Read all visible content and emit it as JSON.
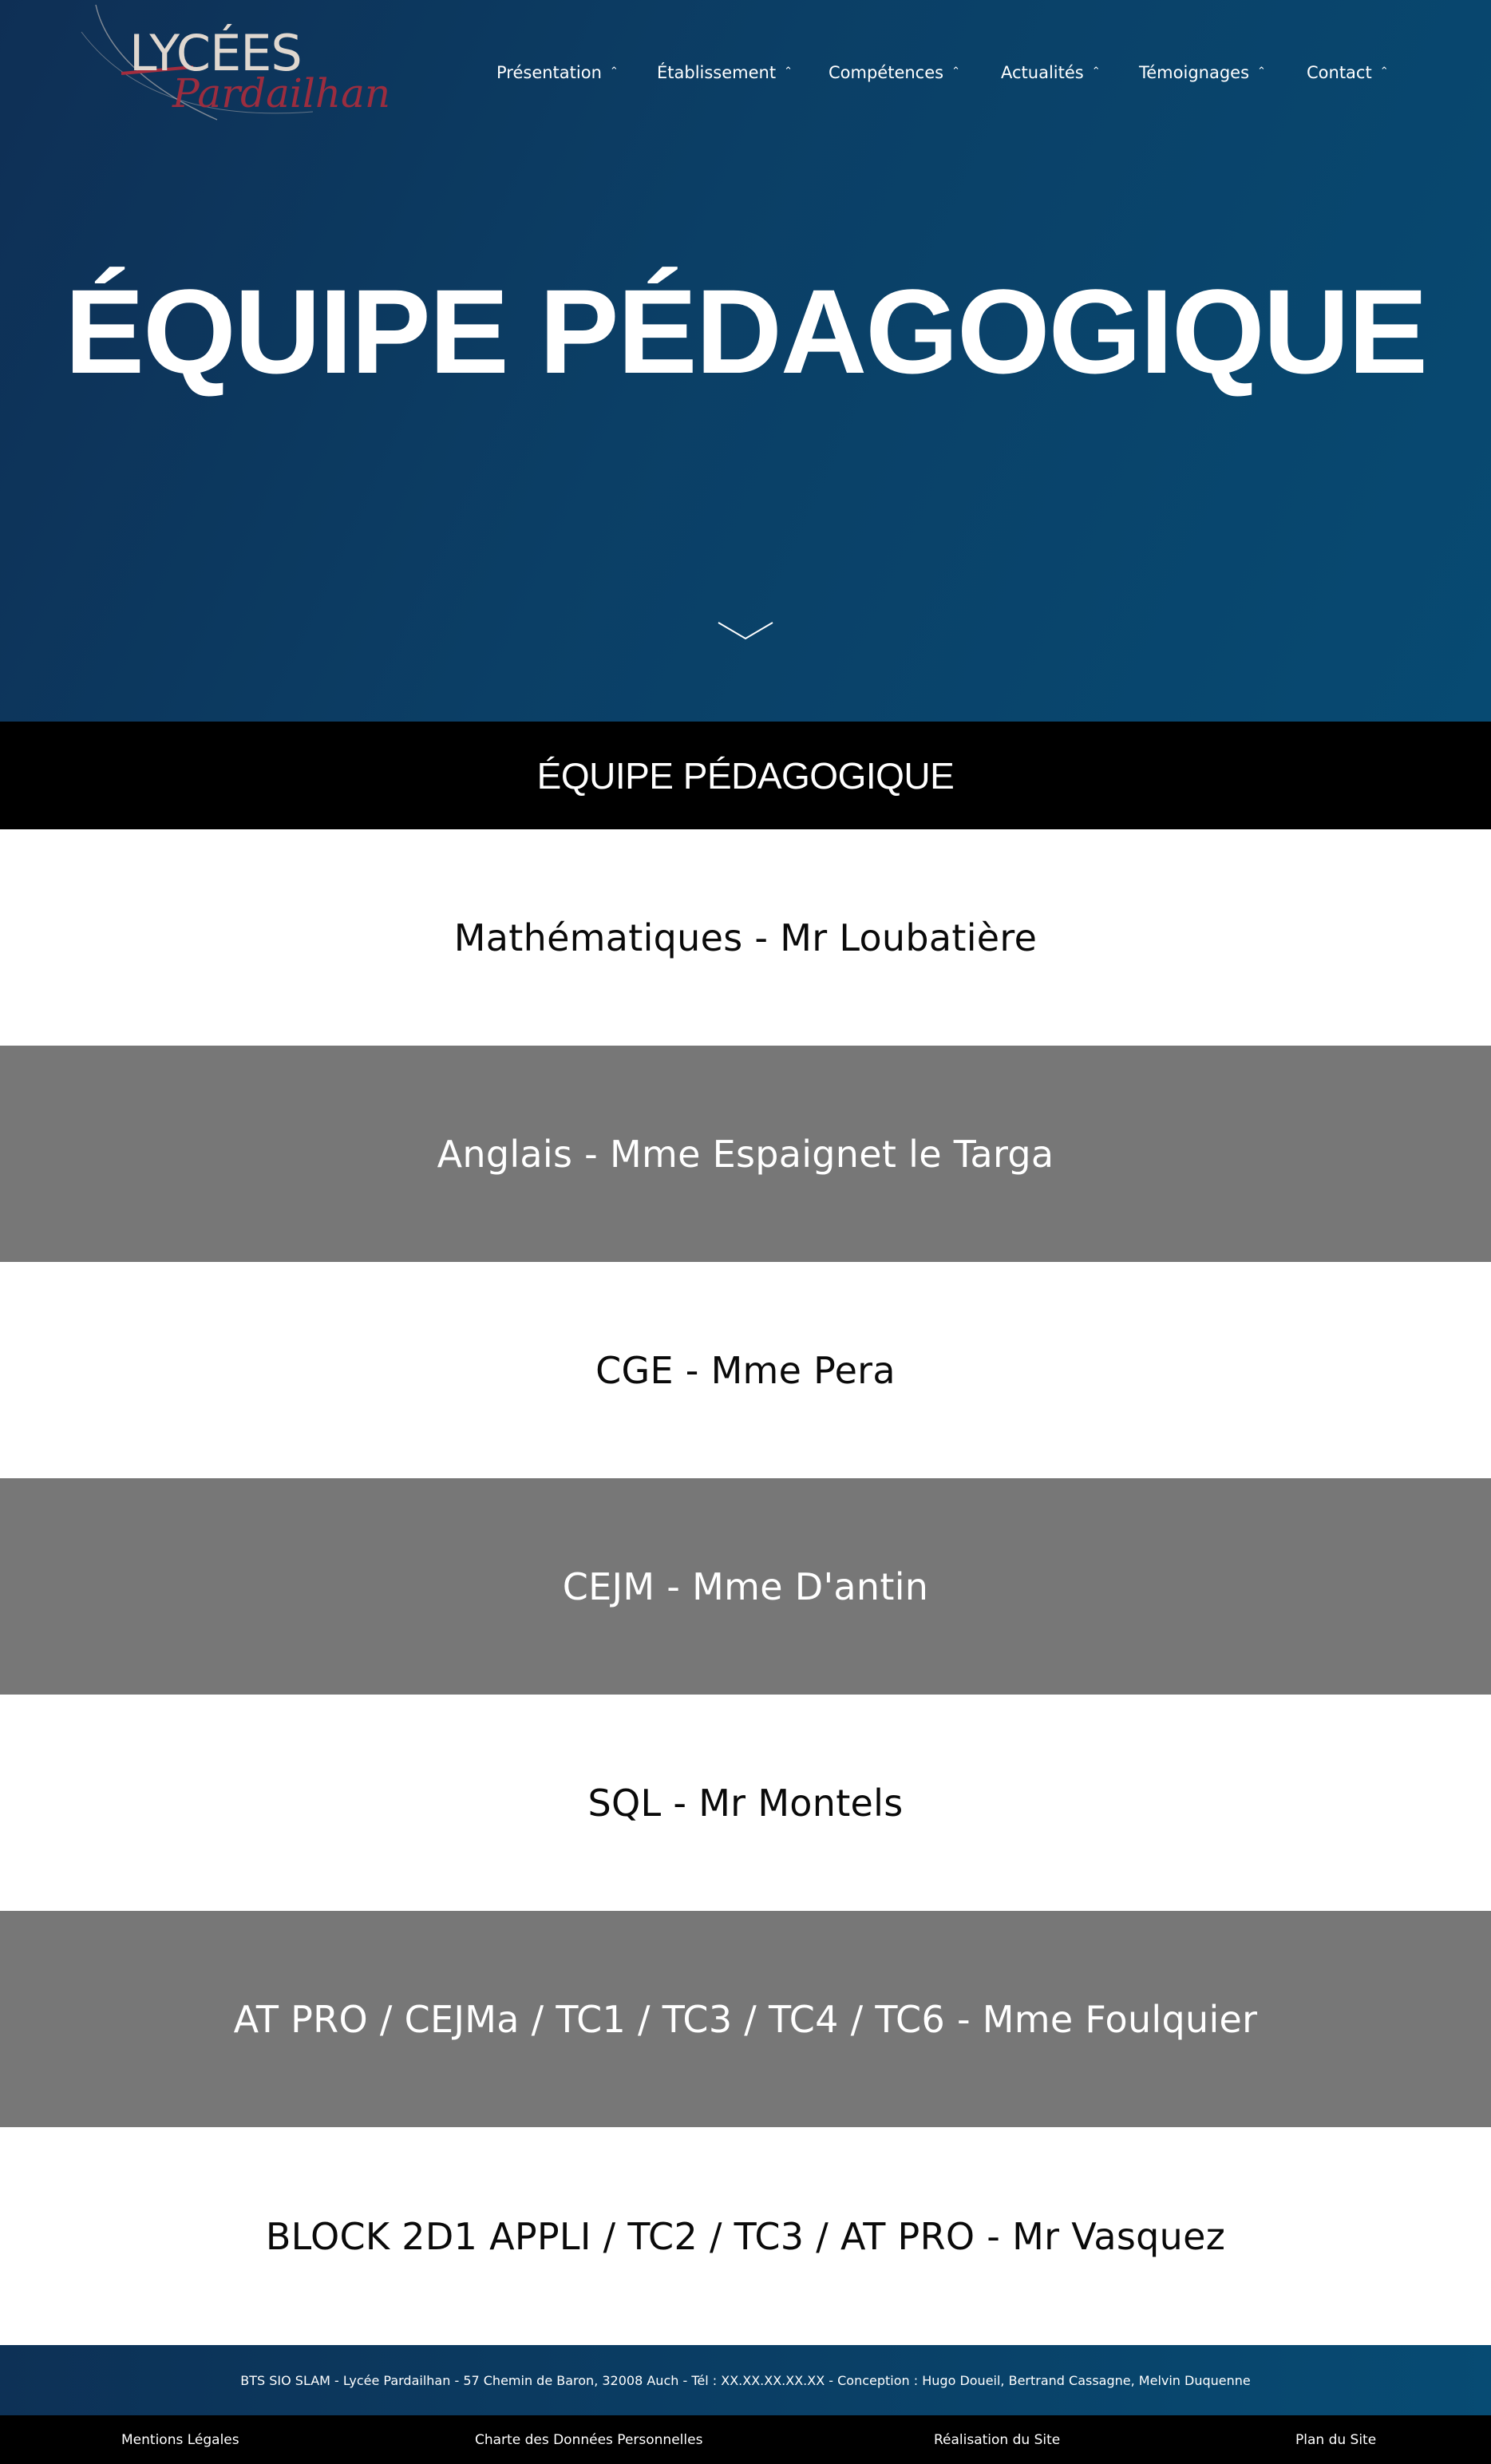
{
  "logo": {
    "wordmark": "LYCÉES",
    "subtitle": "Pardailhan",
    "accent": "#a32d3e"
  },
  "nav": {
    "items": [
      {
        "label": "Présentation",
        "icon": "chevron-up-icon"
      },
      {
        "label": "Établissement",
        "icon": "chevron-up-icon"
      },
      {
        "label": "Compétences",
        "icon": "chevron-up-icon"
      },
      {
        "label": "Actualités",
        "icon": "chevron-up-icon"
      },
      {
        "label": "Témoignages",
        "icon": "chevron-up-icon"
      },
      {
        "label": "Contact",
        "icon": "chevron-up-icon"
      }
    ]
  },
  "hero": {
    "title": "ÉQUIPE PÉDAGOGIQUE",
    "scroll_icon": "chevron-down-icon"
  },
  "section": {
    "title": "ÉQUIPE PÉDAGOGIQUE"
  },
  "staff": [
    "Mathématiques - Mr Loubatière",
    "Anglais - Mme Espaignet le Targa",
    "CGE - Mme Pera",
    "CEJM - Mme D'antin",
    "SQL - Mr Montels",
    "AT PRO / CEJMa / TC1 / TC3 / TC4 / TC6 - Mme Foulquier",
    "BLOCK 2D1 APPLI / TC2 / TC3 / AT PRO - Mr Vasquez"
  ],
  "footer": {
    "info": "BTS SIO SLAM - Lycée Pardailhan - 57 Chemin de Baron, 32008 Auch - Tél : XX.XX.XX.XX.XX - Conception : Hugo Doueil, Bertrand Cassagne, Melvin Duquenne",
    "links": [
      "Mentions Légales",
      "Charte des Données Personnelles",
      "Réalisation du Site",
      "Plan du Site"
    ]
  },
  "colors": {
    "hero_start": "#0e2f55",
    "hero_end": "#074a72",
    "row_dark": "#777777",
    "bar": "#000000"
  }
}
